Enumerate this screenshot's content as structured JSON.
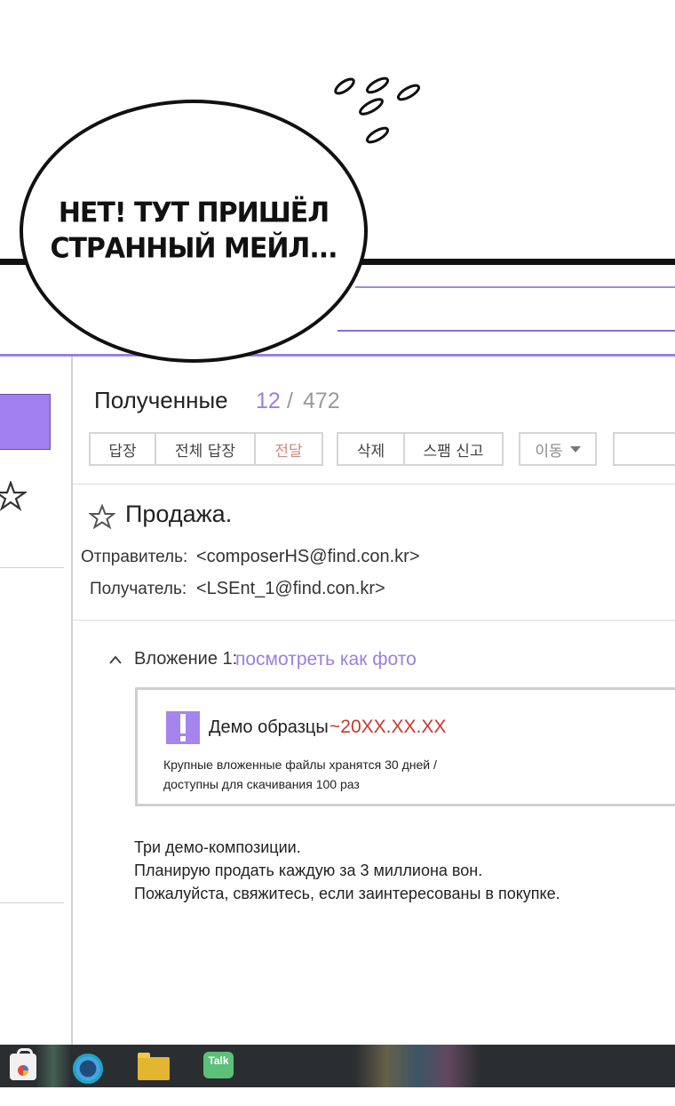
{
  "comic": {
    "speech_line_1": "НЕТ! ТУТ ПРИШЁЛ",
    "speech_line_2": "СТРАННЫЙ МЕЙЛ..."
  },
  "toolbar": {
    "folder_title": "Полученные",
    "unread_count": "12",
    "separator": "/",
    "total_count": "472",
    "reply": "답장",
    "reply_all": "전체 답장",
    "forward": "전달",
    "delete": "삭제",
    "report_spam": "스팸 신고",
    "move": "이동"
  },
  "message": {
    "subject": "Продажа.",
    "sender_label": "Отправитель:",
    "sender": "<composerHS@find.con.kr>",
    "recipient_label": "Получатель:",
    "recipient": "<LSEnt_1@find.con.kr>",
    "attachment_label": "Вложение 1:",
    "attachment_link": "посмотреть как фото",
    "file_name": "Демо образцы",
    "file_date": "~20XX.XX.XX",
    "file_note_1": "Крупные вложенные файлы хранятся 30 дней /",
    "file_note_2": "доступны для скачивания 100 раз",
    "body_1": "Три демо-композиции.",
    "body_2": "Планирую продать каждую за 3 миллиона вон.",
    "body_3": "Пожалуйста, свяжитесь, если заинтересованы в покупке."
  },
  "taskbar": {
    "talk_label": "Talk"
  },
  "colors": {
    "accent": "#9b7fe0",
    "date_red": "#c8392e",
    "taskbar": "#2b2e31"
  }
}
